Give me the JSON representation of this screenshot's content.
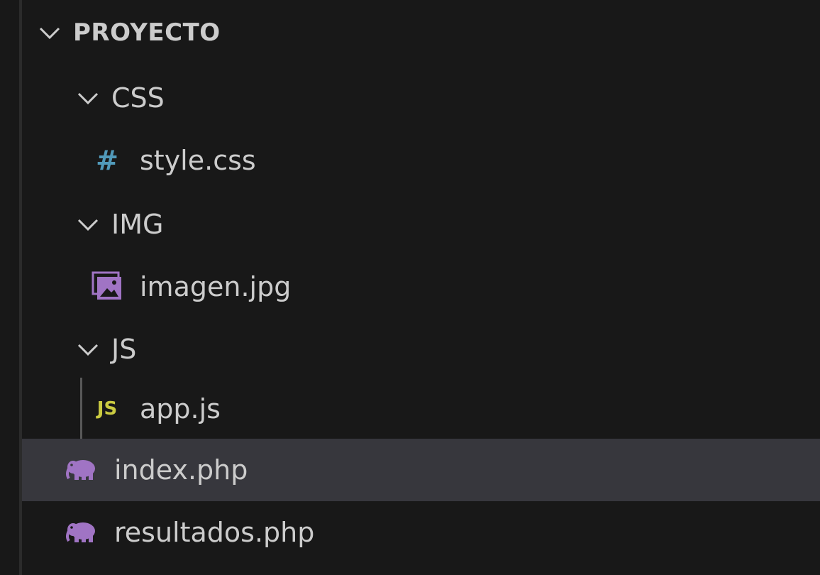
{
  "explorer": {
    "root": {
      "label": "PROYECTO",
      "expanded": true
    },
    "items": [
      {
        "label": "CSS",
        "type": "folder",
        "expanded": true,
        "icon": "chevron-down-icon"
      },
      {
        "label": "style.css",
        "type": "file",
        "icon": "css-hash-icon",
        "icon_text": "#"
      },
      {
        "label": "IMG",
        "type": "folder",
        "expanded": true,
        "icon": "chevron-down-icon"
      },
      {
        "label": "imagen.jpg",
        "type": "file",
        "icon": "image-file-icon"
      },
      {
        "label": "JS",
        "type": "folder",
        "expanded": true,
        "icon": "chevron-down-icon"
      },
      {
        "label": "app.js",
        "type": "file",
        "icon": "js-file-icon",
        "icon_text": "JS"
      },
      {
        "label": "index.php",
        "type": "file",
        "icon": "php-elephant-icon",
        "selected": true
      },
      {
        "label": "resultados.php",
        "type": "file",
        "icon": "php-elephant-icon"
      }
    ]
  },
  "colors": {
    "background": "#181818",
    "selected_row": "#37373d",
    "text": "#cccccc",
    "css_icon": "#519aba",
    "js_icon": "#cbcb41",
    "php_icon": "#a074c4",
    "image_icon": "#a074c4"
  }
}
